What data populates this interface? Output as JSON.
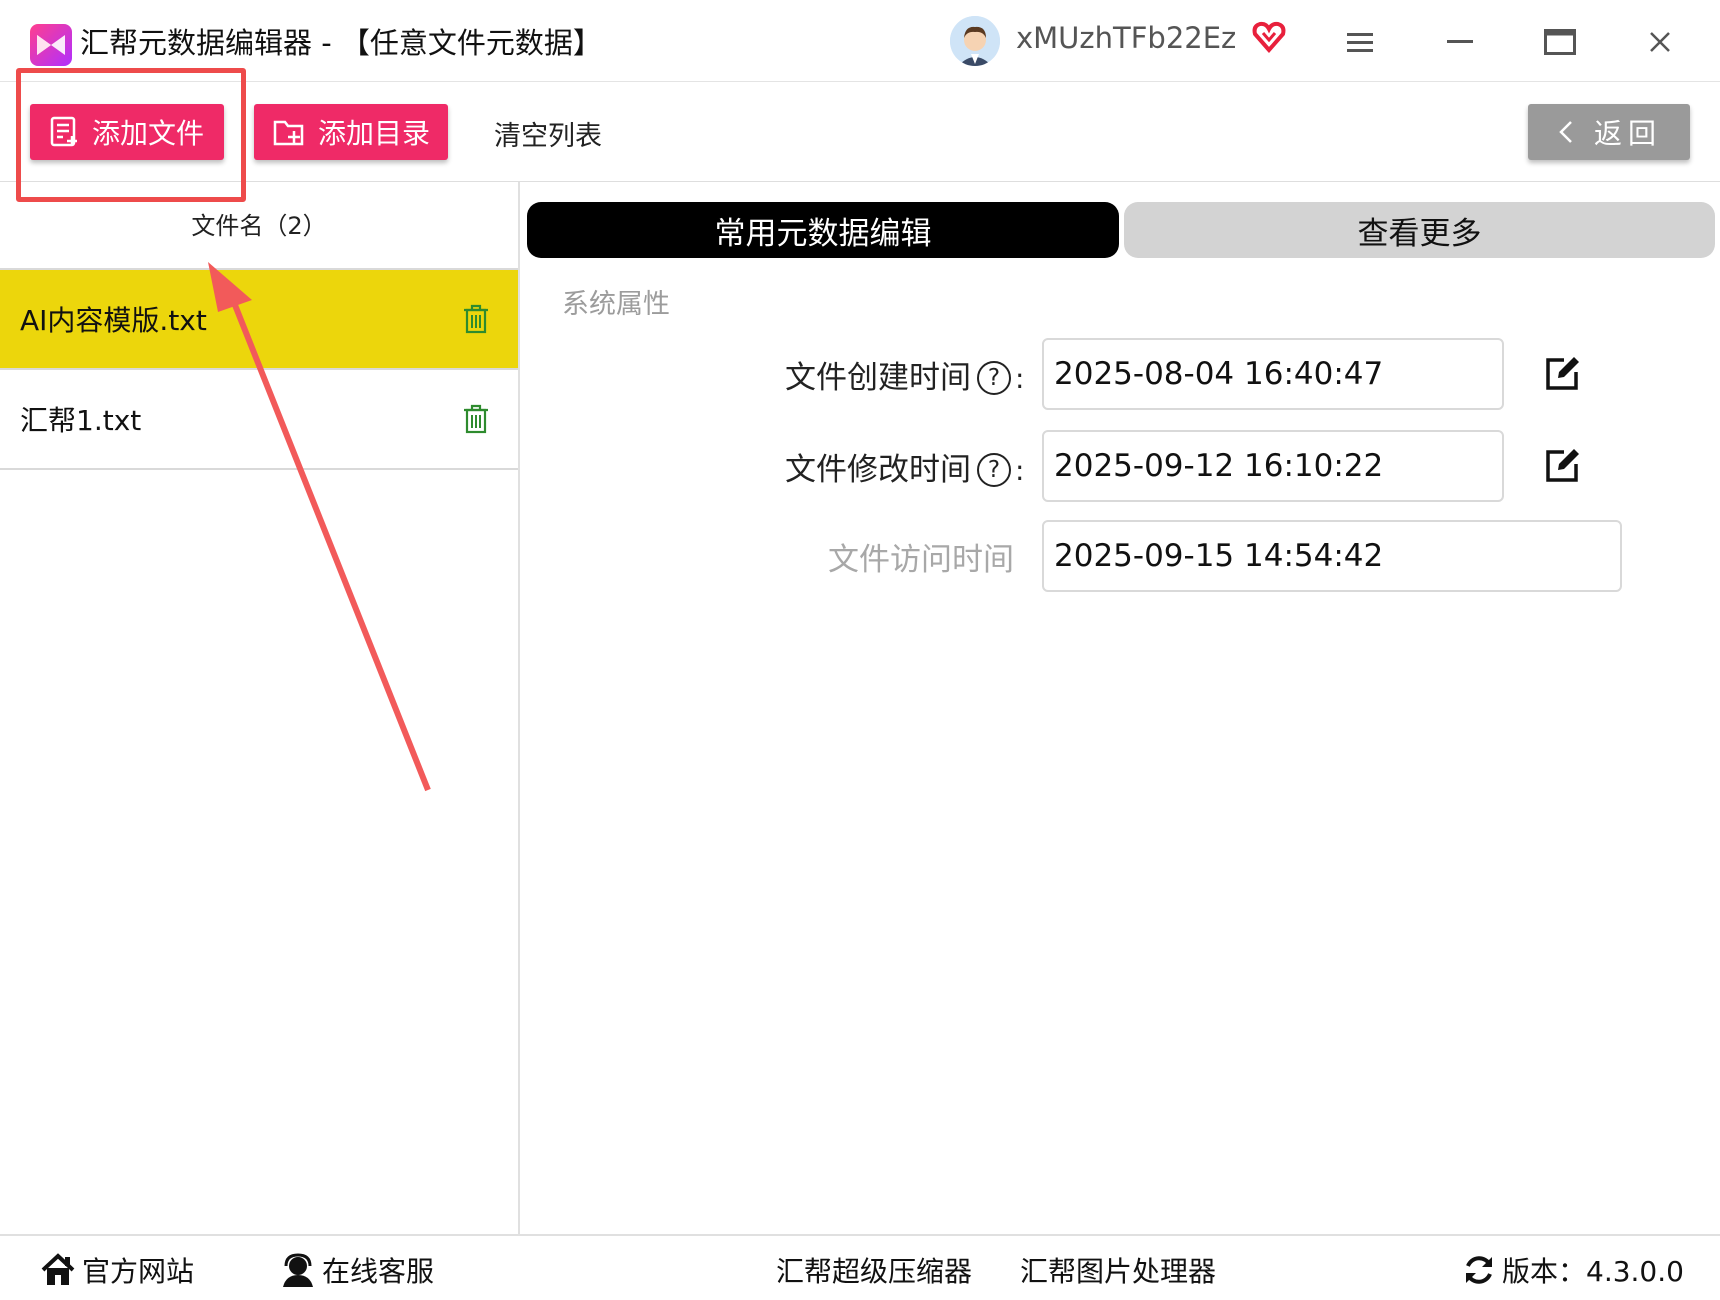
{
  "window": {
    "title": "汇帮元数据编辑器 - 【任意文件元数据】",
    "username": "xMUzhTFb22Ez",
    "icons": [
      "app-logo-icon",
      "avatar",
      "vip-heart-icon",
      "menu-icon",
      "minimize-icon",
      "maximize-icon",
      "close-icon"
    ]
  },
  "toolbar": {
    "add_file": "添加文件",
    "add_dir": "添加目录",
    "clear_list": "清空列表",
    "back": "返回"
  },
  "file_list": {
    "header": "文件名（2）",
    "files": [
      {
        "name": "AI内容模版.txt",
        "selected": true
      },
      {
        "name": "汇帮1.txt",
        "selected": false
      }
    ]
  },
  "tabs": {
    "common": "常用元数据编辑",
    "more": "查看更多"
  },
  "properties": {
    "section": "系统属性",
    "created_label": "文件创建时间",
    "created_value": "2025-08-04 16:40:47",
    "modified_label": "文件修改时间",
    "modified_value": "2025-09-12 16:10:22",
    "accessed_label": "文件访问时间",
    "accessed_value": "2025-09-15 14:54:42",
    "help_mark": "?",
    "colon": ":"
  },
  "footer": {
    "website": "官方网站",
    "support": "在线客服",
    "compressor": "汇帮超级压缩器",
    "image_tool": "汇帮图片处理器",
    "version": "版本：4.3.0.0"
  },
  "colors": {
    "accent_pink": "#ef2a67",
    "selected_row": "#ecd60c",
    "annotation_red": "#ee4b4b",
    "trash_green": "#2e8b2e"
  }
}
